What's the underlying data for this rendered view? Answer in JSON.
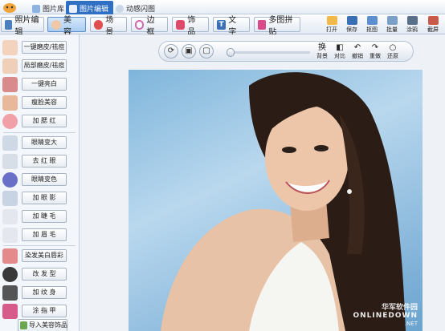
{
  "tabs": [
    {
      "label": "图片库",
      "active": false
    },
    {
      "label": "图片编辑",
      "active": true
    },
    {
      "label": "动感闪图",
      "active": false
    }
  ],
  "toolbar": {
    "buttons": [
      {
        "label": "照片编辑",
        "active": false
      },
      {
        "label": "美 容",
        "active": true
      },
      {
        "label": "场 景",
        "active": false
      },
      {
        "label": "边 框",
        "active": false
      },
      {
        "label": "饰 品",
        "active": false
      },
      {
        "label": "文 字",
        "active": false
      },
      {
        "label": "多图拼贴",
        "active": false
      }
    ],
    "right_tools": [
      "打开",
      "保存",
      "抠图",
      "批量",
      "涂鸦",
      "截屏"
    ]
  },
  "left_panel": {
    "items": [
      "一键磨皮/祛痘",
      "局部磨皮/祛痘",
      "一键亮白",
      "瘦脸美容",
      "加 腮 红",
      "眼睛变大",
      "去 红 眼",
      "眼睛变色",
      "加 眼 影",
      "加 睫 毛",
      "加 眉 毛",
      "染发美白唇彩",
      "改 发 型",
      "加 纹 身",
      "涂 指 甲"
    ],
    "import_label": "导入美容饰品"
  },
  "viewbar": {
    "tools": [
      {
        "glyph": "换",
        "label": "背景"
      },
      {
        "glyph": "◧",
        "label": "对比"
      },
      {
        "glyph": "↶",
        "label": "撤销"
      },
      {
        "glyph": "↷",
        "label": "重做"
      },
      {
        "glyph": "○",
        "label": "还原"
      }
    ]
  },
  "watermark": {
    "line1": "华军软件园",
    "line2": "ONLINEDOWN",
    "line3": ".NET"
  },
  "colors": {
    "accent": "#2f6fc4",
    "active_tool": "#a9cdf2",
    "photo_bg": "#7fb5db"
  }
}
